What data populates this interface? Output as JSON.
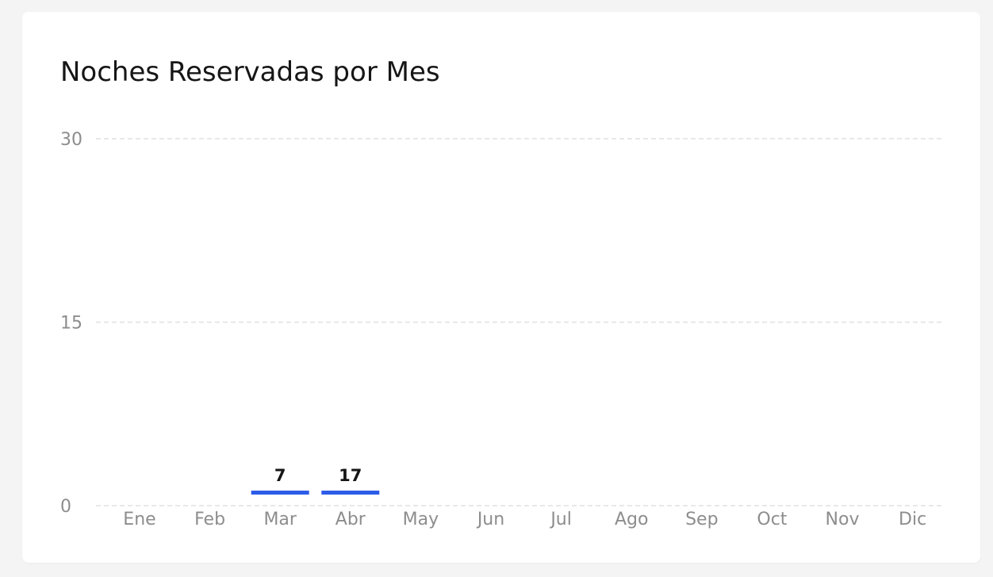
{
  "card": {
    "title": "Noches Reservadas por Mes"
  },
  "colors": {
    "bar": "#2d5ce8",
    "grid": "#e0e0e0",
    "tick_text": "#8d8d8d",
    "label_text": "#161616"
  },
  "chart_data": {
    "type": "bar",
    "title": "Noches Reservadas por Mes",
    "xlabel": "",
    "ylabel": "",
    "categories": [
      "Ene",
      "Feb",
      "Mar",
      "Abr",
      "May",
      "Jun",
      "Jul",
      "Ago",
      "Sep",
      "Oct",
      "Nov",
      "Dic"
    ],
    "values": [
      0,
      0,
      7,
      17,
      0,
      0,
      0,
      0,
      0,
      0,
      0,
      0
    ],
    "ylim": [
      0,
      30
    ],
    "y_ticks": [
      0,
      15,
      30
    ],
    "grid": true,
    "grid_style": "dashed",
    "data_labels": [
      {
        "category": "Mar",
        "text": "7"
      },
      {
        "category": "Abr",
        "text": "17"
      }
    ]
  }
}
